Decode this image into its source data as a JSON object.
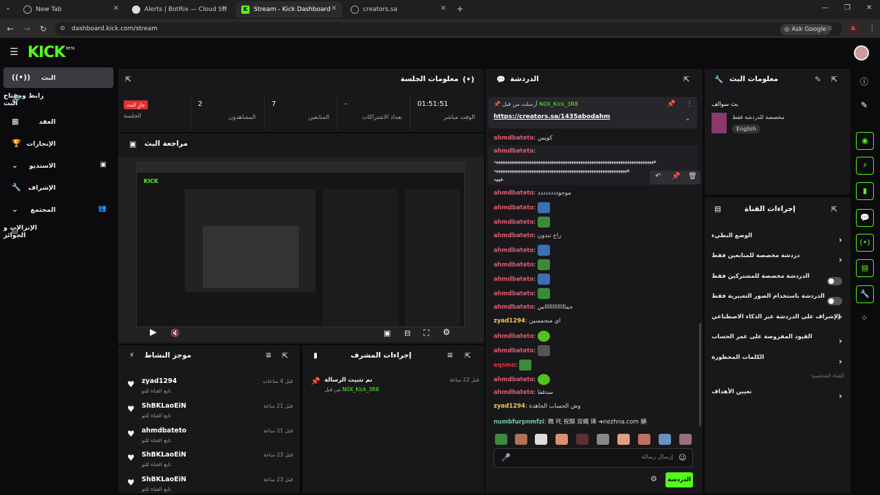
{
  "browser": {
    "tabs": [
      {
        "label": "New Tab"
      },
      {
        "label": "Alerts | BotRix — Cloud Streami"
      },
      {
        "label": "Stream - Kick Dashboard"
      },
      {
        "label": "creators.sa"
      }
    ],
    "url": "dashboard.kick.com/stream",
    "ask_google": "Ask Google",
    "profile_letter": "A"
  },
  "header": {
    "logo": "KICK",
    "beta": "BETA"
  },
  "sidebar": {
    "items": [
      {
        "label": "البث"
      },
      {
        "label": "رابط ومفتاح البث"
      },
      {
        "label": "العقد"
      },
      {
        "label": "الإنجازات"
      },
      {
        "label": "الاستديو"
      },
      {
        "label": "الإشراف"
      },
      {
        "label": "المجتمع"
      },
      {
        "label": "الإنزالات و الجوائز"
      }
    ]
  },
  "session": {
    "title": "معلومات الجلسة",
    "live_badge": "جارٍ البث",
    "stats": [
      {
        "value": "",
        "label": "الجلسة"
      },
      {
        "value": "2",
        "label": "المشاهدون"
      },
      {
        "value": "7",
        "label": "المتابعين"
      },
      {
        "value": "-",
        "label": "تعداد الاشتراكات"
      },
      {
        "value": "01:51:51",
        "label": "الوقت مباشر"
      }
    ]
  },
  "preview": {
    "title": "مراجعة البث"
  },
  "activity": {
    "title": "موجز النشاط",
    "items": [
      {
        "name": "zyad1294",
        "sub": "تابع القناة للتو",
        "time": "قبل 4 ساعات"
      },
      {
        "name": "ShBKLaoEiN",
        "sub": "تابع القناة للتو",
        "time": "قبل 21 ساعة"
      },
      {
        "name": "ahmdbateto",
        "sub": "تابع القناة للتو",
        "time": "قبل 21 ساعة"
      },
      {
        "name": "ShBKLaoEiN",
        "sub": "تابع القناة للتو",
        "time": "قبل 23 ساعة"
      },
      {
        "name": "ShBKLaoEiN",
        "sub": "تابع القناة للتو",
        "time": "قبل 23 ساعة"
      }
    ]
  },
  "mod_actions": {
    "title": "إجراءات المشرف",
    "item_title": "تم تثبيت الرسالة",
    "item_by": "من قبل",
    "item_user": "N0X_Kick_3R8",
    "item_time": "قبل 22 ساعة"
  },
  "chat": {
    "title": "الدردشة",
    "pinned_by": "أرسلت من قبل",
    "pinned_user": "N0X_Kick_3R8",
    "pinned_link": "https://creators.sa/1435abodahm",
    "messages": [
      {
        "user": "ahmdbateto",
        "text": "كويس"
      },
      {
        "user": "ahmdbateto",
        "text": ""
      },
      {
        "user": "",
        "text": "ههههههههههههههههههههههههههههههههههههههههههههههههههههههههههههههههههههههههه"
      },
      {
        "user": "",
        "text": "ههههههههههههههههههههههههههههههههههههههههههههههههههههههههههههه"
      },
      {
        "user": "",
        "text": "هههه"
      },
      {
        "user": "ahmdbateto",
        "text": "موجودددددددد"
      },
      {
        "user": "ahmdbateto",
        "text": ""
      },
      {
        "user": "ahmdbateto",
        "text": ""
      },
      {
        "user": "ahmdbateto",
        "text": "راح تندون"
      },
      {
        "user": "ahmdbateto",
        "text": ""
      },
      {
        "user": "ahmdbateto",
        "text": ""
      },
      {
        "user": "ahmdbateto",
        "text": ""
      },
      {
        "user": "ahmdbateto",
        "text": ""
      },
      {
        "user": "ahmdbateto",
        "text": "حماااااااااااااس"
      },
      {
        "user": "zyad1294",
        "text": "اي متحمسين"
      },
      {
        "user": "ahmdbateto",
        "text": ""
      },
      {
        "user": "ahmdbateto",
        "text": ""
      },
      {
        "user": "eqsmo",
        "text": ""
      },
      {
        "user": "ahmdbateto",
        "text": ""
      },
      {
        "user": "ahmdbateto",
        "text": "سدقفا"
      },
      {
        "user": "zyad1294",
        "text": "وش الحساب الجاهدة"
      },
      {
        "user": "numbfurpnmfzi",
        "text": "瞧 吒 祝頤 双蠅 璜 ➜nezhna.com 觵"
      }
    ],
    "input_placeholder": "إرسال رسالة",
    "send_label": "الدردشة"
  },
  "stream_info": {
    "title": "معلومات البث",
    "stream_title": "بث سوالف",
    "category": "مخصصة للدردشة فقط",
    "language": "English"
  },
  "channel_actions": {
    "title": "إجراءات القناة",
    "items": [
      {
        "label": "الوضع البطيء",
        "control": "arrow"
      },
      {
        "label": "دردشة مخصصة للمتابعين فقط",
        "control": "arrow"
      },
      {
        "label": "الدردشة مخصصة للمشتركين فقط",
        "control": "toggle"
      },
      {
        "label": "الدردشة باستخدام الصور التعبيرية فقط",
        "control": "toggle"
      },
      {
        "label": "الإشراف على الدردشة عبر الذكاء الاصطناعي",
        "control": "icon"
      },
      {
        "label": "القيود المفروضة على عمر الحساب",
        "control": "arrow"
      },
      {
        "label": "الكلمات المحظورة",
        "control": "arrow"
      }
    ],
    "section_label": "القناة الشخصية",
    "goals_label": "تعيين الأهداف"
  }
}
